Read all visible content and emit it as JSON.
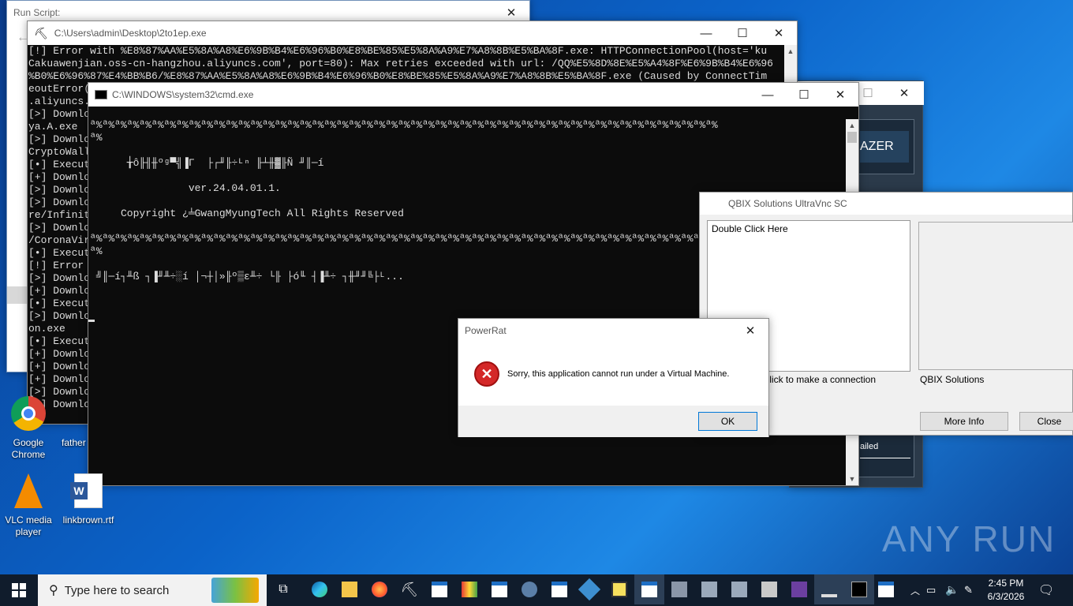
{
  "run_script": {
    "title": "Run Script:"
  },
  "console1": {
    "title": "C:\\Users\\admin\\Desktop\\2to1ep.exe",
    "lines": [
      "[!] Error with %E8%87%AA%E5%8A%A8%E6%9B%B4%E6%96%B0%E8%BE%85%E5%8A%A9%E7%A8%8B%E5%BA%8F.exe: HTTPConnectionPool(host='ku",
      "Cakuawenjian.oss-cn-hangzhou.aliyuncs.com', port=80): Max retries exceeded with url: /QQ%E5%8D%8E%E5%A4%8F%E6%9B%B4%E6%96",
      "%B0%E6%96%87%E4%BB%B6/%E8%87%AA%E5%8A%A8%E6%9B%B4%E6%96%B0%E8%BE%85%E5%8A%A9%E7%A8%8B%E5%BA%8F.exe (Caused by ConnectTim",
      "eoutError(",
      ".aliyuncs.",
      "[>] Downlo",
      "ya.A.exe",
      "[>] Downlo",
      "CryptoWall",
      "[•] Execut",
      "[+] Downlo",
      "[>] Downlo",
      "[>] Downlo",
      "re/Infinit",
      "[>] Downlo",
      "/CoronaVir",
      "[•] Execut",
      "[!] Error ",
      "[>] Downlo",
      "[+] Downlo",
      "[•] Execut",
      "[>] Downlo",
      "on.exe",
      "[•] Execut",
      "[+] Downlo",
      "[+] Downlo",
      "[+] Downlo",
      "[>] Downlo",
      "[+] Downlo"
    ]
  },
  "cmd": {
    "title": "C:\\WINDOWS\\system32\\cmd.exe",
    "lines": [
      "ª%ª%ª%ª%ª%ª%ª%ª%ª%ª%ª%ª%ª%ª%ª%ª%ª%ª%ª%ª%ª%ª%ª%ª%ª%ª%ª%ª%ª%ª%ª%ª%ª%ª%ª%ª%ª%ª%ª%ª%ª%ª%ª%ª%ª%ª%ª%ª%ª%ª%ª%",
      "ª%",
      "",
      "      ╁ô╟╢╫ºᵍ▀╣▐Γ  ├┌╜╟÷ᴸⁿ ╟┴╫▓╟Ñ ╜║─í",
      "",
      "                ver.24.04.01.1.",
      "",
      "     Copyright ¿╧GwangMyungTech All Rights Reserved",
      "",
      "ª%ª%ª%ª%ª%ª%ª%ª%ª%ª%ª%ª%ª%ª%ª%ª%ª%ª%ª%ª%ª%ª%ª%ª%ª%ª%ª%ª%ª%ª%ª%ª%ª%ª%ª%ª%ª%ª%ª%ª%ª%ª%ª%ª%ª%ª%ª%ª%ª%ª%ª%",
      "ª%",
      "",
      " ╝║─í┐╨ß ┐▐╜╨÷░í │¬┼│»╟º▒ε╨÷ └╟ ├ó╙ ┤▐╨÷ ┐╫╜╜╚├ᴸ..."
    ]
  },
  "blazer": {
    "button_text": "AZER",
    "status_text": "ailed"
  },
  "qbix": {
    "title": "QBIX Solutions UltraVnc SC",
    "list_item": "Double Click Here",
    "left_caption": "Click to make a connection",
    "right_caption": "QBIX Solutions",
    "more_info": "More Info",
    "close": "Close"
  },
  "powerrat": {
    "title": "PowerRat",
    "message": "Sorry, this application cannot run under a Virtual Machine.",
    "ok": "OK"
  },
  "desktop": {
    "icons": [
      {
        "label": "Google Chrome",
        "icon": "chrome-icon"
      },
      {
        "label": "father",
        "icon": "file-icon"
      },
      {
        "label": "VLC media player",
        "icon": "vlc-icon"
      },
      {
        "label": "linkbrown.rtf",
        "icon": "word-icon"
      }
    ],
    "watermark": "ANY RUN"
  },
  "taskbar": {
    "search_placeholder": "Type here to search",
    "time": "2:45 PM",
    "date": "6/3/2026"
  },
  "colors": {
    "desktop": "#0b63c9",
    "console_bg": "#0c0c0c",
    "error_red": "#d42828",
    "blazer_bg": "#1b2a3a"
  }
}
